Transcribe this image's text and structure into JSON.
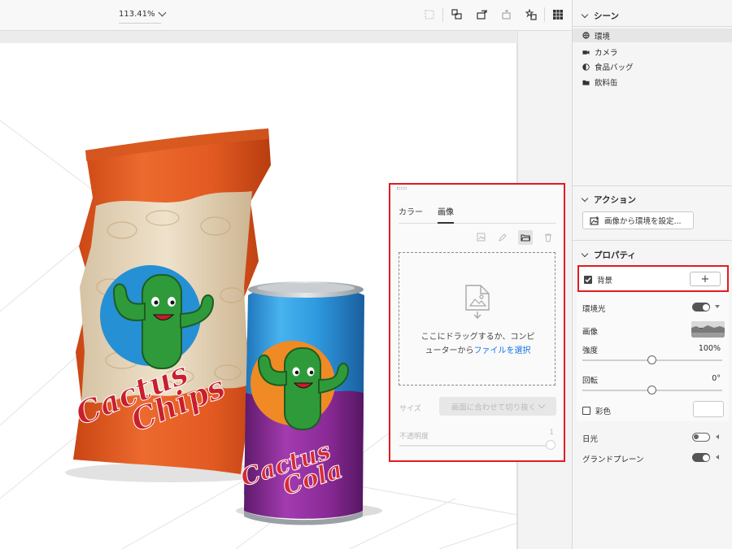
{
  "toolbar": {
    "zoom_value": "113.41%",
    "icons": [
      "frame-icon",
      "transform-icon",
      "rotate-camera-icon",
      "pan-camera-icon",
      "add-light-icon",
      "grid-toggle-icon"
    ]
  },
  "scene_panel": {
    "title": "シーン",
    "items": [
      {
        "label": "環境",
        "icon": "globe-icon",
        "selected": true
      },
      {
        "label": "カメラ",
        "icon": "camera-icon",
        "selected": false
      },
      {
        "label": "食品バッグ",
        "icon": "material-icon",
        "selected": false
      },
      {
        "label": "飲料缶",
        "icon": "folder-icon",
        "selected": false
      }
    ]
  },
  "actions_panel": {
    "title": "アクション",
    "button_label": "画像から環境を設定..."
  },
  "properties_panel": {
    "title": "プロパティ",
    "background": {
      "label": "背景",
      "checked": true,
      "add_label": "+"
    },
    "environment_light": {
      "label": "環境光",
      "on": true
    },
    "image": {
      "label": "画像"
    },
    "intensity": {
      "label": "強度",
      "value": "100%",
      "fraction": 1.0
    },
    "rotation": {
      "label": "回転",
      "value": "0°",
      "fraction": 0.5
    },
    "tint": {
      "label": "彩色",
      "checked": false
    },
    "sunlight": {
      "label": "日光",
      "on": false
    },
    "ground_plane": {
      "label": "グランドプレーン",
      "on": true
    }
  },
  "background_popover": {
    "tabs": [
      {
        "label": "カラー",
        "active": false
      },
      {
        "label": "画像",
        "active": true
      }
    ],
    "tools": [
      "replace-image-icon",
      "edit-pencil-icon",
      "open-folder-icon",
      "delete-trash-icon"
    ],
    "dropzone": {
      "text_line1": "ここにドラッグするか、コンピ",
      "text_line2_prefix": "ューターから",
      "link_text": "ファイルを選択"
    },
    "size_label": "サイズ",
    "size_value": "画面に合わせて切り抜く",
    "opacity_label": "不透明度",
    "opacity_value": "1"
  },
  "scene_artwork": {
    "chip_bag_text": [
      "Cactus",
      "Chips"
    ],
    "can_text": [
      "Cactus",
      "Cola"
    ],
    "colors": {
      "bag_orange": "#e4551e",
      "can_blue": "#2d9be0",
      "can_purple": "#8a2a96",
      "cactus_green": "#2f9a3a",
      "logo_red": "#d72a35"
    }
  },
  "highlight_color": "#e21b22",
  "link_color": "#1473e6"
}
